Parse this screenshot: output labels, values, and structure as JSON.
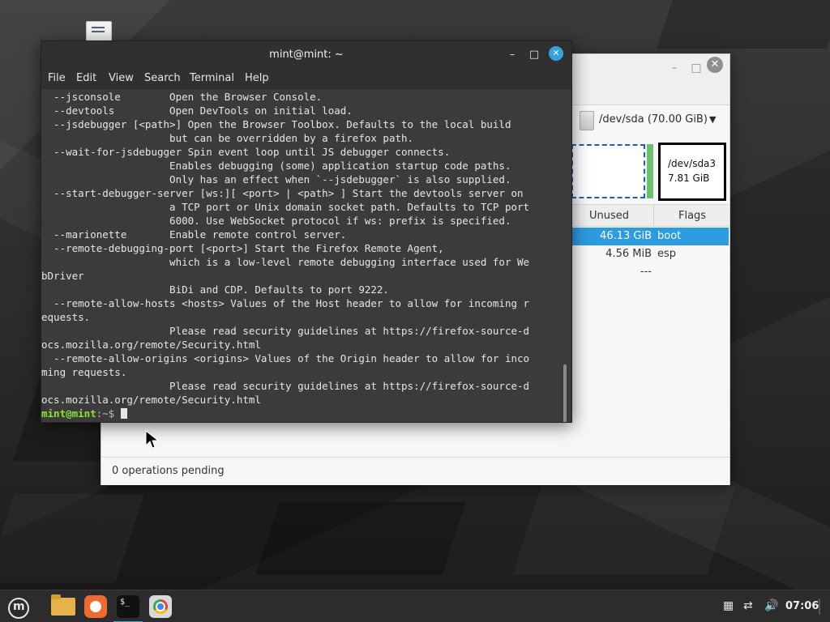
{
  "terminal": {
    "title": "mint@mint: ~",
    "menu": [
      "File",
      "Edit",
      "View",
      "Search",
      "Terminal",
      "Help"
    ],
    "lines": [
      "  --jsconsole        Open the Browser Console.",
      "  --devtools         Open DevTools on initial load.",
      "  --jsdebugger [<path>] Open the Browser Toolbox. Defaults to the local build",
      "                     but can be overridden by a firefox path.",
      "  --wait-for-jsdebugger Spin event loop until JS debugger connects.",
      "                     Enables debugging (some) application startup code paths.",
      "                     Only has an effect when `--jsdebugger` is also supplied.",
      "  --start-debugger-server [ws:][ <port> | <path> ] Start the devtools server on",
      "                     a TCP port or Unix domain socket path. Defaults to TCP port",
      "                     6000. Use WebSocket protocol if ws: prefix is specified.",
      "  --marionette       Enable remote control server.",
      "  --remote-debugging-port [<port>] Start the Firefox Remote Agent,",
      "                     which is a low-level remote debugging interface used for We",
      "bDriver",
      "                     BiDi and CDP. Defaults to port 9222.",
      "  --remote-allow-hosts <hosts> Values of the Host header to allow for incoming r",
      "equests.",
      "                     Please read security guidelines at https://firefox-source-d",
      "ocs.mozilla.org/remote/Security.html",
      "  --remote-allow-origins <origins> Values of the Origin header to allow for inco",
      "ming requests.",
      "                     Please read security guidelines at https://firefox-source-d",
      "ocs.mozilla.org/remote/Security.html"
    ],
    "prompt_user": "mint@mint",
    "prompt_path": ":~$ "
  },
  "gparted": {
    "device": "/dev/sda (70.00 GiB)",
    "partition_label": "/dev/sda3",
    "partition_size": "7.81 GiB",
    "col_unused": "Unused",
    "col_flags": "Flags",
    "rows": [
      {
        "unused": "46.13 GiB",
        "flags": "boot"
      },
      {
        "unused": "4.56 MiB",
        "flags": "esp"
      },
      {
        "unused": "---",
        "flags": ""
      }
    ],
    "status": "0 operations pending"
  },
  "taskbar": {
    "clock": "07:06"
  },
  "icons": {
    "menu": "linux-mint-icon",
    "files": "folder-icon",
    "firefox": "firefox-icon",
    "terminal": "terminal-icon",
    "chrome": "chrome-icon"
  },
  "colors": {
    "accent": "#35a2e0",
    "selection": "#2d9be0",
    "prompt_green": "#8ae234"
  }
}
